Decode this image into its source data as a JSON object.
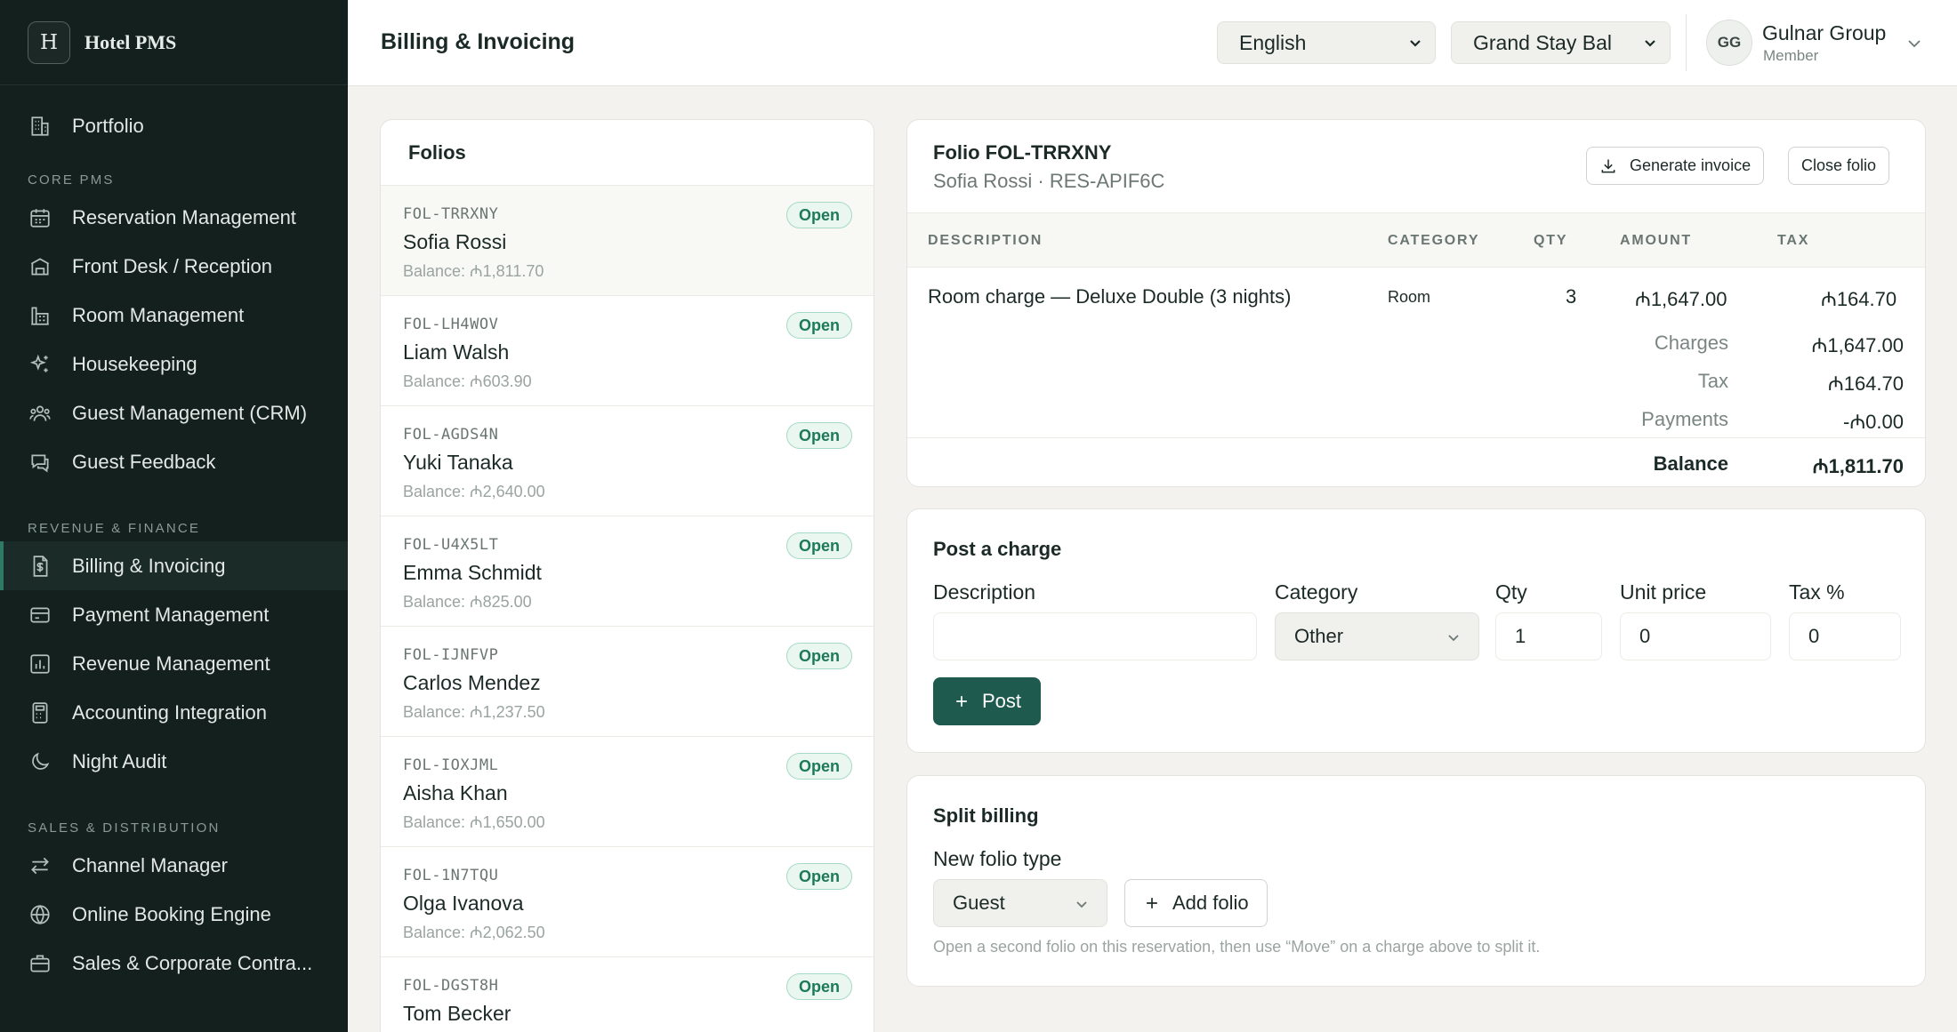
{
  "brand": {
    "logo_letter": "H",
    "name": "Hotel PMS"
  },
  "sidebar": {
    "top_items": [
      {
        "label": "Portfolio",
        "icon": "building-icon"
      }
    ],
    "sections": [
      {
        "title": "CORE PMS",
        "items": [
          {
            "label": "Reservation Management",
            "icon": "calendar-icon"
          },
          {
            "label": "Front Desk / Reception",
            "icon": "desk-icon"
          },
          {
            "label": "Room Management",
            "icon": "hotel-icon"
          },
          {
            "label": "Housekeeping",
            "icon": "sparkles-icon"
          },
          {
            "label": "Guest Management (CRM)",
            "icon": "users-icon"
          },
          {
            "label": "Guest Feedback",
            "icon": "chat-icon"
          }
        ]
      },
      {
        "title": "REVENUE & FINANCE",
        "items": [
          {
            "label": "Billing & Invoicing",
            "icon": "receipt-icon",
            "active": true
          },
          {
            "label": "Payment Management",
            "icon": "card-icon"
          },
          {
            "label": "Revenue Management",
            "icon": "bar-chart-icon"
          },
          {
            "label": "Accounting Integration",
            "icon": "calculator-icon"
          },
          {
            "label": "Night Audit",
            "icon": "moon-icon"
          }
        ]
      },
      {
        "title": "SALES & DISTRIBUTION",
        "items": [
          {
            "label": "Channel Manager",
            "icon": "arrows-icon"
          },
          {
            "label": "Online Booking Engine",
            "icon": "globe-icon"
          },
          {
            "label": "Sales & Corporate Contra...",
            "icon": "briefcase-icon"
          }
        ]
      }
    ]
  },
  "header": {
    "title": "Billing & Invoicing",
    "language": "English",
    "property": "Grand Stay Bal",
    "user_initials": "GG",
    "user_name": "Gulnar Group",
    "user_role": "Member"
  },
  "folios": {
    "title": "Folios",
    "status_label": "Open",
    "items": [
      {
        "code": "FOL-TRRXNY",
        "name": "Sofia Rossi",
        "balance": "Balance: ₼1,811.70"
      },
      {
        "code": "FOL-LH4WOV",
        "name": "Liam Walsh",
        "balance": "Balance: ₼603.90"
      },
      {
        "code": "FOL-AGDS4N",
        "name": "Yuki Tanaka",
        "balance": "Balance: ₼2,640.00"
      },
      {
        "code": "FOL-U4X5LT",
        "name": "Emma Schmidt",
        "balance": "Balance: ₼825.00"
      },
      {
        "code": "FOL-IJNFVP",
        "name": "Carlos Mendez",
        "balance": "Balance: ₼1,237.50"
      },
      {
        "code": "FOL-IOXJML",
        "name": "Aisha Khan",
        "balance": "Balance: ₼1,650.00"
      },
      {
        "code": "FOL-1N7TQU",
        "name": "Olga Ivanova",
        "balance": "Balance: ₼2,062.50"
      },
      {
        "code": "FOL-DGST8H",
        "name": "Tom Becker",
        "balance": ""
      }
    ]
  },
  "folio_detail": {
    "title": "Folio FOL-TRRXNY",
    "subtitle": "Sofia Rossi · RES-APIF6C",
    "generate_invoice": "Generate invoice",
    "close_folio": "Close folio",
    "columns": {
      "description": "DESCRIPTION",
      "category": "CATEGORY",
      "qty": "QTY",
      "amount": "AMOUNT",
      "tax": "TAX"
    },
    "rows": [
      {
        "description": "Room charge — Deluxe Double (3 nights)",
        "category": "Room",
        "qty": "3",
        "amount": "₼1,647.00",
        "tax": "₼164.70"
      }
    ],
    "summary": {
      "charges_label": "Charges",
      "charges": "₼1,647.00",
      "tax_label": "Tax",
      "tax": "₼164.70",
      "payments_label": "Payments",
      "payments": "-₼0.00",
      "balance_label": "Balance",
      "balance": "₼1,811.70"
    }
  },
  "post_charge": {
    "title": "Post a charge",
    "description_label": "Description",
    "description_value": "",
    "category_label": "Category",
    "category_value": "Other",
    "qty_label": "Qty",
    "qty_value": "1",
    "unit_price_label": "Unit price",
    "unit_price_value": "0",
    "tax_label": "Tax %",
    "tax_value": "0",
    "post_button": "Post"
  },
  "split_billing": {
    "title": "Split billing",
    "type_label": "New folio type",
    "type_value": "Guest",
    "add_button": "Add folio",
    "hint": "Open a second folio on this reservation, then use “Move” on a charge above to split it."
  },
  "colors": {
    "sidebar_bg": "#14201d",
    "accent": "#1e5b4e",
    "badge_green": "#1d7a57"
  }
}
